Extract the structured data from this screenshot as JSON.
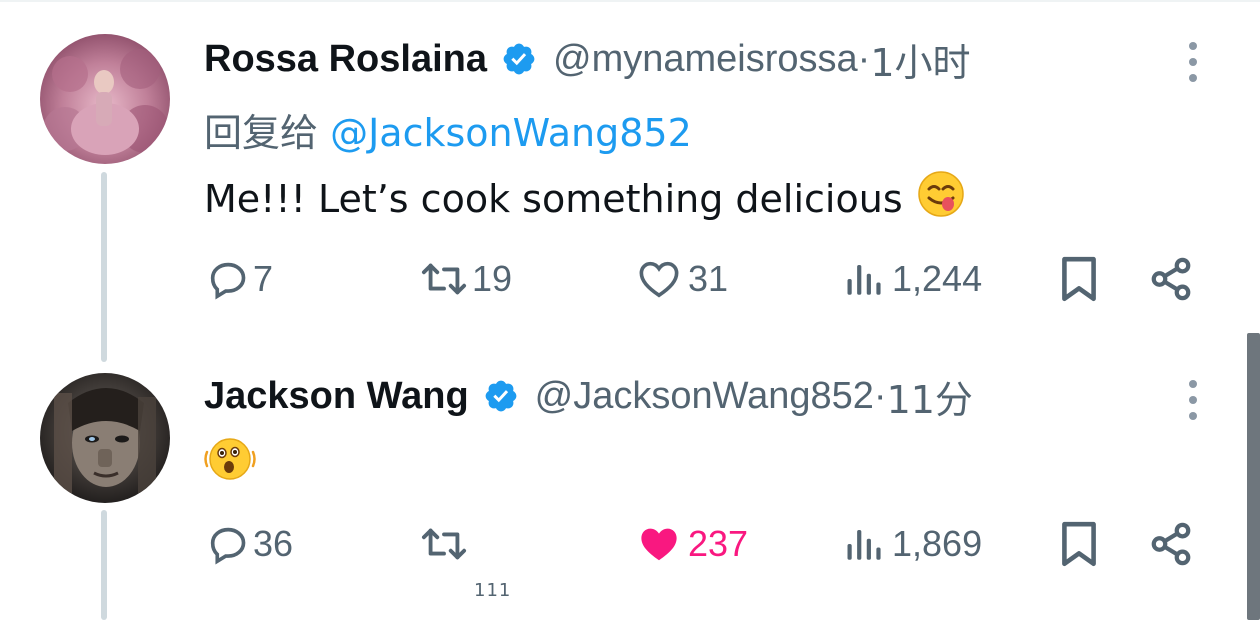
{
  "tweets": [
    {
      "name": "Rossa Roslaina",
      "handle": "@mynameisrossa",
      "time_sep": " · ",
      "time": "1小时",
      "reply_prefix": "回复给 ",
      "reply_handle": "@JacksonWang852",
      "text": "Me!!! Let’s cook something delicious",
      "emoji": "yum-face",
      "replies": "7",
      "retweets": "19",
      "likes": "31",
      "liked": false,
      "views": "1,244"
    },
    {
      "name": "Jackson Wang",
      "handle": "@JacksonWang852",
      "time_sep": " · ",
      "time": "11分",
      "emoji": "astonished-shaking-face",
      "replies": "36",
      "retweets": "",
      "likes": "237",
      "liked": true,
      "views": "1,869",
      "overlay_text": "111"
    }
  ],
  "colors": {
    "verified": "#1d9bf0",
    "link": "#1d9bf0",
    "secondary": "#536471",
    "liked": "#f91880",
    "thread_line": "#cfd9de"
  }
}
